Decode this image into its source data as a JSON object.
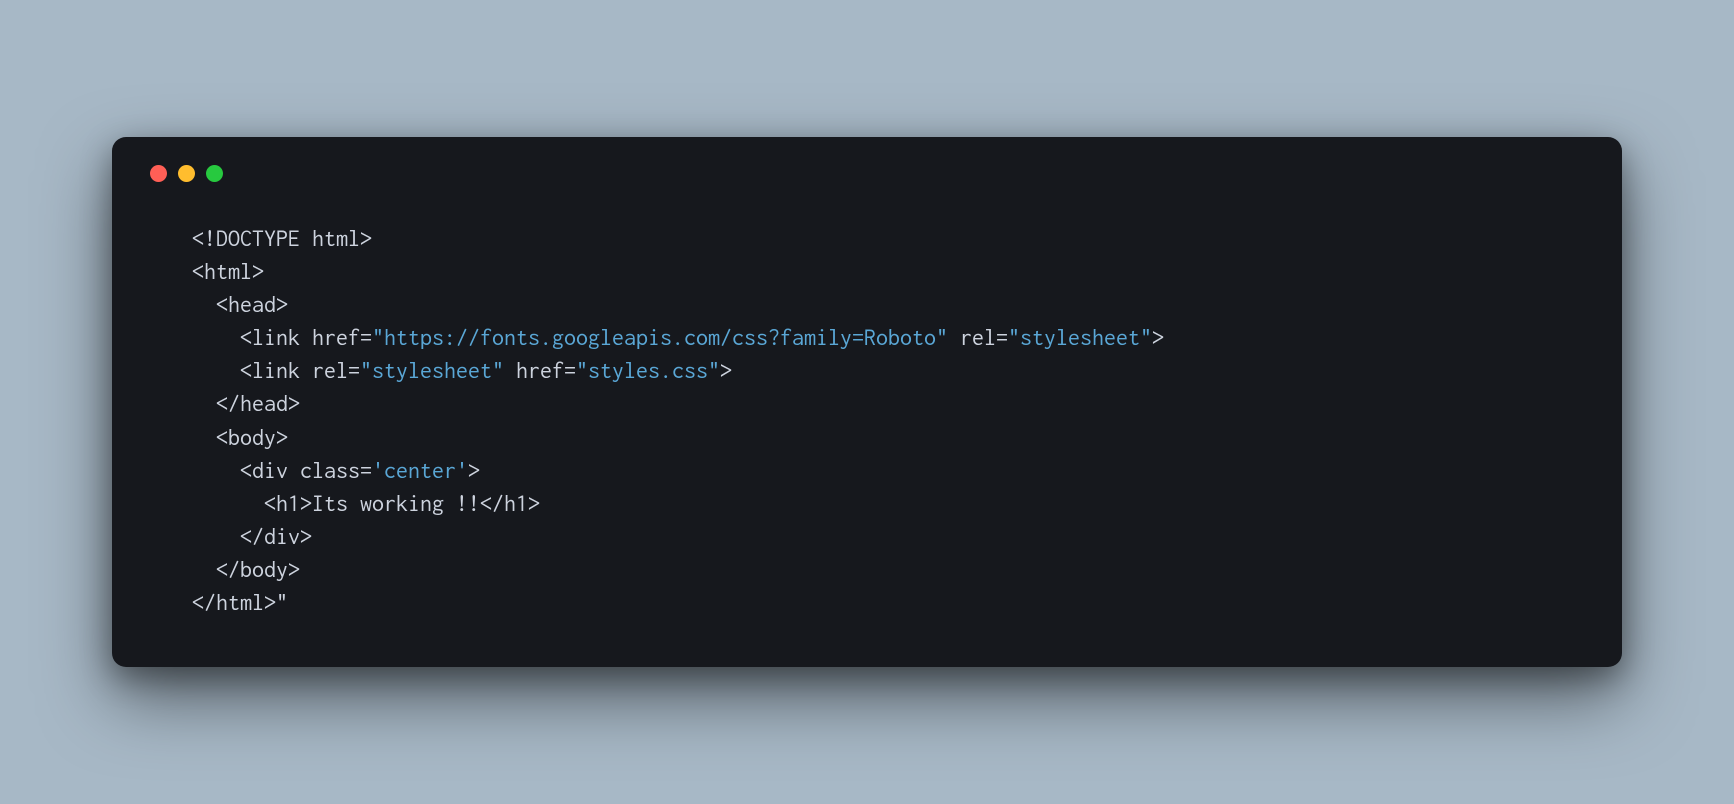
{
  "window": {
    "traffic_lights": {
      "red": "#ff5f56",
      "yellow": "#ffbd2e",
      "green": "#27c93f"
    }
  },
  "code": {
    "line1": {
      "open": "<!",
      "doctype": "DOCTYPE",
      "space": " ",
      "html": "html",
      "close": ">"
    },
    "line2": {
      "open": "<",
      "tag": "html",
      "close": ">"
    },
    "line3": {
      "indent": "  ",
      "open": "<",
      "tag": "head",
      "close": ">"
    },
    "line4": {
      "indent": "    ",
      "open": "<",
      "tag": "link",
      "space1": " ",
      "attr1": "href",
      "eq1": "=",
      "val1": "\"https://fonts.googleapis.com/css?family=Roboto\"",
      "space2": " ",
      "attr2": "rel",
      "eq2": "=",
      "val2": "\"stylesheet\"",
      "close": ">"
    },
    "line5": {
      "indent": "    ",
      "open": "<",
      "tag": "link",
      "space1": " ",
      "attr1": "rel",
      "eq1": "=",
      "val1": "\"stylesheet\"",
      "space2": " ",
      "attr2": "href",
      "eq2": "=",
      "val2": "\"styles.css\"",
      "close": ">"
    },
    "line6": {
      "indent": "  ",
      "open": "</",
      "tag": "head",
      "close": ">"
    },
    "line7": {
      "indent": "  ",
      "open": "<",
      "tag": "body",
      "close": ">"
    },
    "line8": {
      "indent": "    ",
      "open": "<",
      "tag": "div",
      "space1": " ",
      "attr1": "class",
      "eq1": "=",
      "val1": "'center'",
      "close": ">"
    },
    "line9": {
      "indent": "      ",
      "open": "<",
      "tag": "h1",
      "close": ">",
      "text": "Its working !!",
      "open2": "</",
      "tag2": "h1",
      "close2": ">"
    },
    "line10": {
      "indent": "    ",
      "open": "</",
      "tag": "div",
      "close": ">"
    },
    "line11": {
      "indent": "  ",
      "open": "</",
      "tag": "body",
      "close": ">"
    },
    "line12": {
      "open": "</",
      "tag": "html",
      "close": ">",
      "trail": "\""
    }
  }
}
